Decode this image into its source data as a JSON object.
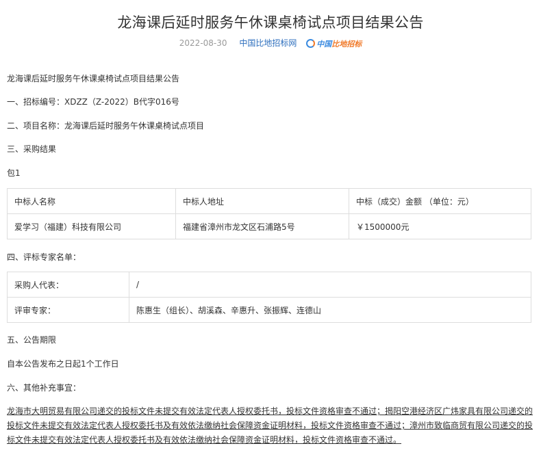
{
  "header": {
    "title": "龙海课后延时服务午休课桌椅试点项目结果公告",
    "date": "2022-08-30",
    "source": "中国比地招标网",
    "logo_text_a": "中国",
    "logo_text_b": "比地招标"
  },
  "body": {
    "intro": "龙海课后延时服务午休课桌椅试点项目结果公告",
    "bid_no": "一、招标编号：XDZZ（Z-2022）B代字016号",
    "project_name": "二、项目名称：龙海课后延时服务午休课桌椅试点项目",
    "result_heading": "三、采购结果",
    "package": "包1",
    "result_table": {
      "headers": [
        "中标人名称",
        "中标人地址",
        "中标（成交）金额 （单位：元）"
      ],
      "row": [
        "爱学习（福建）科技有限公司",
        "福建省漳州市龙文区石浦路5号",
        "￥1500000元"
      ]
    },
    "experts_heading": "四、评标专家名单：",
    "experts_table": {
      "rows": [
        [
          "采购人代表：",
          "/"
        ],
        [
          "评审专家：",
          "陈惠生（组长）、胡溪森、辛惠升、张振辉、连德山"
        ]
      ]
    },
    "period_heading": "五、公告期限",
    "period_text": "自本公告发布之日起1个工作日",
    "other_heading": "六、其他补充事宜：",
    "other_text": "龙海市大明贸易有限公司递交的投标文件未提交有效法定代表人授权委托书，投标文件资格审查不通过；揭阳空港经济区广炜家具有限公司递交的投标文件未提交有效法定代表人授权委托书及有效依法缴纳社会保障资金证明材料，投标文件资格审查不通过；漳州市致临商贸有限公司递交的投标文件未提交有效法定代表人授权委托书及有效依法缴纳社会保障资金证明材料，投标文件资格审查不通过。"
  },
  "colors": {
    "link": "#2c6ebd",
    "muted": "#999999",
    "border": "#dddddd",
    "text": "#333333",
    "logo_blue": "#3b8be0",
    "logo_orange": "#f07a2a"
  }
}
